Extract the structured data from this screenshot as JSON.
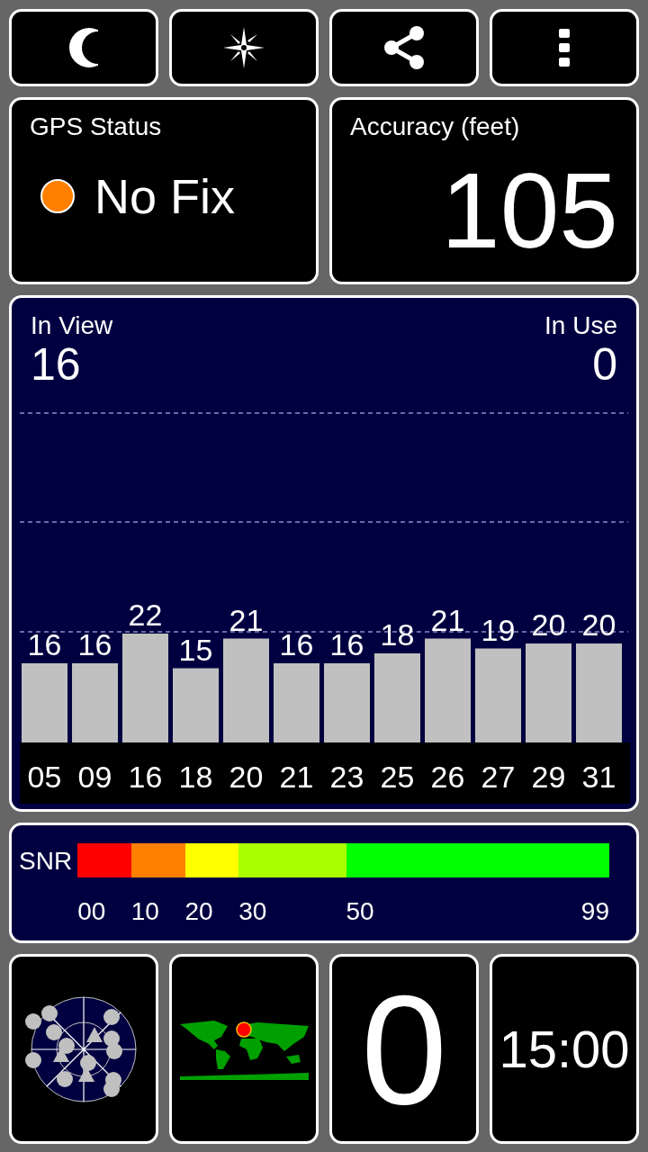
{
  "toolbar": {
    "buttons": [
      {
        "kind": "night"
      },
      {
        "kind": "compass"
      },
      {
        "kind": "share"
      },
      {
        "kind": "menu"
      }
    ]
  },
  "gps_status": {
    "title": "GPS Status",
    "value": "No Fix",
    "color": "#ff8000"
  },
  "accuracy": {
    "title": "Accuracy (feet)",
    "value": "105"
  },
  "satellites": {
    "in_view_label": "In View",
    "in_view": "16",
    "in_use_label": "In Use",
    "in_use": "0",
    "chart_data": {
      "type": "bar",
      "categories": [
        "05",
        "09",
        "16",
        "18",
        "20",
        "21",
        "23",
        "25",
        "26",
        "27",
        "29",
        "31"
      ],
      "values": [
        16,
        16,
        22,
        15,
        21,
        16,
        16,
        18,
        21,
        19,
        20,
        20
      ],
      "data_labels": true
    }
  },
  "snr": {
    "label": "SNR",
    "segments": [
      {
        "color": "#ff0000"
      },
      {
        "color": "#ff8000"
      },
      {
        "color": "#ffff00"
      },
      {
        "color": "#aaff00"
      },
      {
        "color": "#00ff00"
      }
    ],
    "ticks": [
      "00",
      "10",
      "20",
      "30",
      "50",
      "99"
    ]
  },
  "bottom_tiles": [
    {
      "kind": "skyplot"
    },
    {
      "kind": "world_map"
    },
    {
      "kind": "text",
      "value": "0"
    },
    {
      "kind": "text",
      "value": "15:00"
    }
  ]
}
